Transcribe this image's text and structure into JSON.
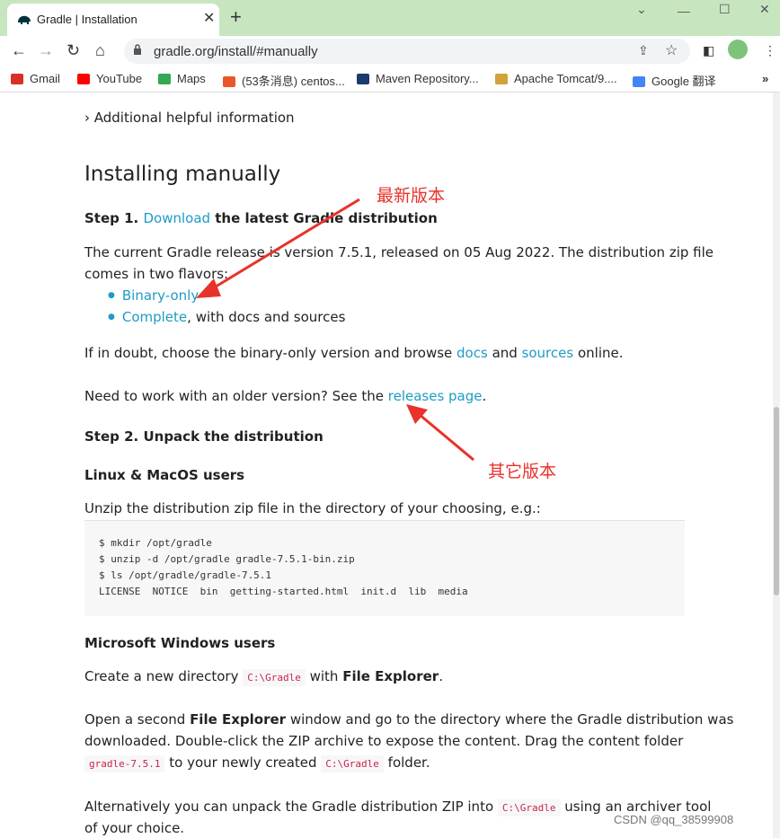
{
  "browser": {
    "tab_title": "Gradle | Installation",
    "url": "gradle.org/install/#manually",
    "bookmarks": [
      {
        "label": "Gmail",
        "color": "#d93025"
      },
      {
        "label": "YouTube",
        "color": "#ff0000"
      },
      {
        "label": "Maps",
        "color": "#34a853"
      },
      {
        "label": "(53条消息) centos...",
        "color": "#e8572a"
      },
      {
        "label": "Maven Repository...",
        "color": "#1b3b6f"
      },
      {
        "label": "Apache Tomcat/9....",
        "color": "#d0a23a"
      },
      {
        "label": "Google 翻译",
        "color": "#4285f4"
      }
    ]
  },
  "page": {
    "additional_info": "› Additional helpful information",
    "heading": "Installing manually",
    "step1_prefix": "Step 1. ",
    "step1_link": "Download",
    "step1_suffix": " the latest Gradle distribution",
    "release_line1": "The current Gradle release is version 7.5.1, released on 05 Aug 2022. The distribution zip file",
    "release_line2": "comes in two flavors:",
    "flavor_binary": "Binary-only",
    "flavor_complete": "Complete",
    "flavor_complete_suffix": ", with docs and sources",
    "doubt_prefix": "If in doubt, choose the binary-only version and browse ",
    "doubt_docs": "docs",
    "doubt_and": " and ",
    "doubt_sources": "sources",
    "doubt_suffix": " online.",
    "older_prefix": "Need to work with an older version? See the ",
    "older_link": "releases page",
    "older_suffix": ".",
    "step2": "Step 2. Unpack the distribution",
    "linux_heading": "Linux & MacOS users",
    "unzip_text": "Unzip the distribution zip file in the directory of your choosing, e.g.:",
    "code_lines": [
      "$ mkdir /opt/gradle",
      "$ unzip -d /opt/gradle gradle-7.5.1-bin.zip",
      "$ ls /opt/gradle/gradle-7.5.1",
      "LICENSE  NOTICE  bin  getting-started.html  init.d  lib  media"
    ],
    "windows_heading": "Microsoft Windows users",
    "create_prefix": "Create a new directory ",
    "create_code": "C:\\Gradle",
    "create_mid": " with ",
    "create_bold": "File Explorer",
    "create_suffix": ".",
    "open_l1_prefix": "Open a second ",
    "open_l1_bold": "File Explorer",
    "open_l1_suffix": " window and go to the directory where the Gradle distribution was",
    "open_l2": "downloaded. Double-click the ZIP archive to expose the content. Drag the content folder",
    "open_l3_code": "gradle-7.5.1",
    "open_l3_mid": " to your newly created ",
    "open_l3_code2": "C:\\Gradle",
    "open_l3_suffix": " folder.",
    "alt_l1_prefix": "Alternatively you can unpack the Gradle distribution ZIP into ",
    "alt_l1_code": "C:\\Gradle",
    "alt_l1_suffix": " using an archiver tool",
    "alt_l2": "of your choice."
  },
  "annotations": {
    "latest": "最新版本",
    "other": "其它版本",
    "color": "#e8322b"
  },
  "watermark": "CSDN @qq_38599908"
}
